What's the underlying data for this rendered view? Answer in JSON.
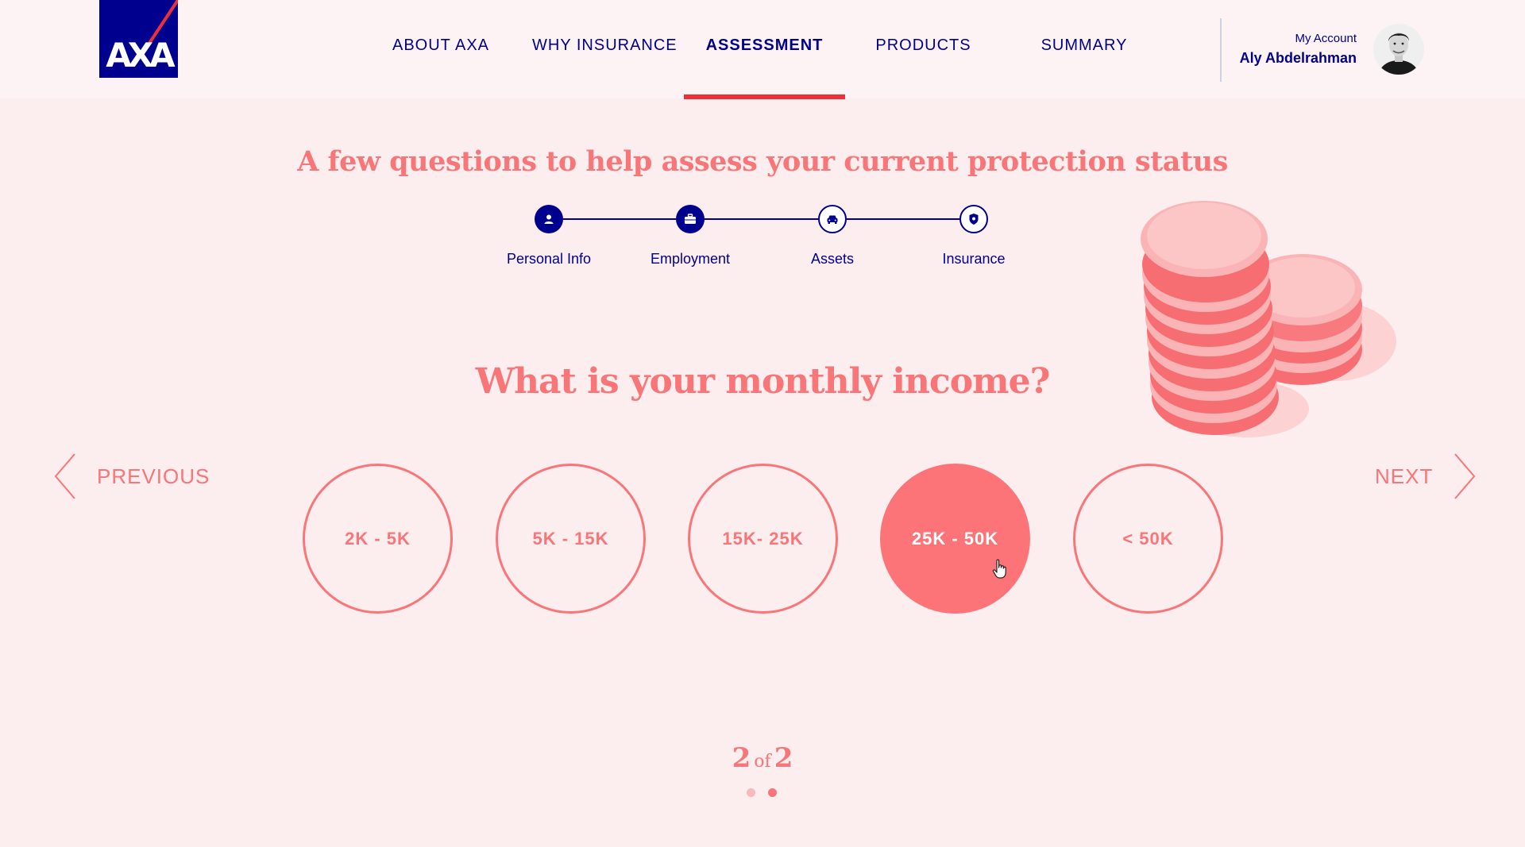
{
  "brand": {
    "logo_text": "AXA",
    "primary": "#00008f",
    "accent_red": "#ee2f3a",
    "coral": "#f87578"
  },
  "nav": {
    "items": [
      "ABOUT AXA",
      "WHY INSURANCE",
      "ASSESSMENT",
      "PRODUCTS",
      "SUMMARY"
    ],
    "active": "ASSESSMENT"
  },
  "account": {
    "link_label": "My Account",
    "user_name": "Aly Abdelrahman"
  },
  "headline": "A few questions to help assess your current protection status",
  "stepper": {
    "steps": [
      {
        "label": "Personal Info",
        "icon": "person-icon",
        "done": true
      },
      {
        "label": "Employment",
        "icon": "briefcase-icon",
        "done": true
      },
      {
        "label": "Assets",
        "icon": "car-icon",
        "done": false
      },
      {
        "label": "Insurance",
        "icon": "shield-icon",
        "done": false
      }
    ]
  },
  "question": "What is your monthly income?",
  "navigation": {
    "previous_label": "PREVIOUS",
    "next_label": "NEXT"
  },
  "options": {
    "items": [
      "2K - 5K",
      "5K - 15K",
      "15K- 25K",
      "25K - 50K",
      "< 50K"
    ],
    "selected": "25K - 50K"
  },
  "pager": {
    "current": "2",
    "of_label": "of",
    "total": "2"
  }
}
